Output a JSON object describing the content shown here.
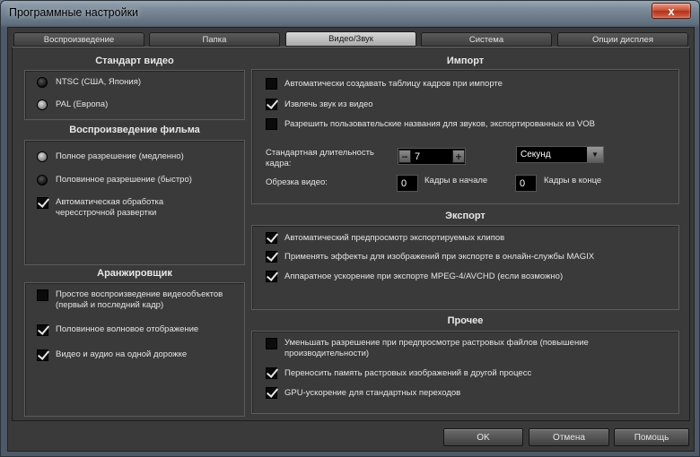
{
  "window": {
    "title": "Программные настройки",
    "close_glyph": "x"
  },
  "tabs": [
    {
      "label": "Воспроизведение",
      "active": false
    },
    {
      "label": "Папка",
      "active": false
    },
    {
      "label": "Видео/Звук",
      "active": true
    },
    {
      "label": "Система",
      "active": false
    },
    {
      "label": "Опции дисплея",
      "active": false
    }
  ],
  "video_standard": {
    "title": "Стандарт видео",
    "options": [
      {
        "label": "NTSC (США, Япония)",
        "selected": false
      },
      {
        "label": "PAL (Европа)",
        "selected": true
      }
    ]
  },
  "movie_playback": {
    "title": "Воспроизведение фильма",
    "options": [
      {
        "label": "Полное разрешение (медленно)",
        "selected": true
      },
      {
        "label": "Половинное разрешение (быстро)",
        "selected": false
      }
    ],
    "deinterlace": {
      "label": "Автоматическая обработка\nчересстрочной развертки",
      "checked": true
    }
  },
  "arranger": {
    "title": "Аранжировщик",
    "items": [
      {
        "label": "Простое воспроизведение видеообъектов\n(первый и последний кадр)",
        "checked": false
      },
      {
        "label": "Половинное волновое отображение",
        "checked": true
      },
      {
        "label": "Видео и аудио на одной дорожке",
        "checked": true
      }
    ]
  },
  "import": {
    "title": "Импорт",
    "items": [
      {
        "label": "Автоматически создавать таблицу кадров при импорте",
        "checked": false
      },
      {
        "label": "Извлечь звук из видео",
        "checked": true
      },
      {
        "label": "Разрешить пользовательские названия для звуков, экспортированных из VOB",
        "checked": false
      }
    ],
    "frame_duration_label": "Стандартная длительность\nкадра:",
    "frame_duration_value": "7",
    "minus_glyph": "−",
    "plus_glyph": "+",
    "unit_value": "Секунд",
    "arrow_glyph": "▼",
    "trim_label": "Обрезка видео:",
    "trim_start_value": "0",
    "trim_start_label": "Кадры в начале",
    "trim_end_value": "0",
    "trim_end_label": "Кадры в конце"
  },
  "export": {
    "title": "Экспорт",
    "items": [
      {
        "label": "Автоматический предпросмотр экспортируемых клипов",
        "checked": true
      },
      {
        "label": "Применять эффекты для изображений при экспорте в онлайн-службы MAGIX",
        "checked": true
      },
      {
        "label": "Аппаратное ускорение при экспорте MPEG-4/AVCHD (если возможно)",
        "checked": true
      }
    ]
  },
  "other": {
    "title": "Прочее",
    "items": [
      {
        "label": "Уменьшать разрешение при предпросмотре растровых файлов (повышение\nпроизводительности)",
        "checked": false
      },
      {
        "label": "Переносить память растровых изображений в другой процесс",
        "checked": true
      },
      {
        "label": "GPU-ускорение для стандартных переходов",
        "checked": true
      }
    ]
  },
  "buttons": {
    "ok": "OK",
    "cancel": "Отмена",
    "help": "Помощь"
  }
}
